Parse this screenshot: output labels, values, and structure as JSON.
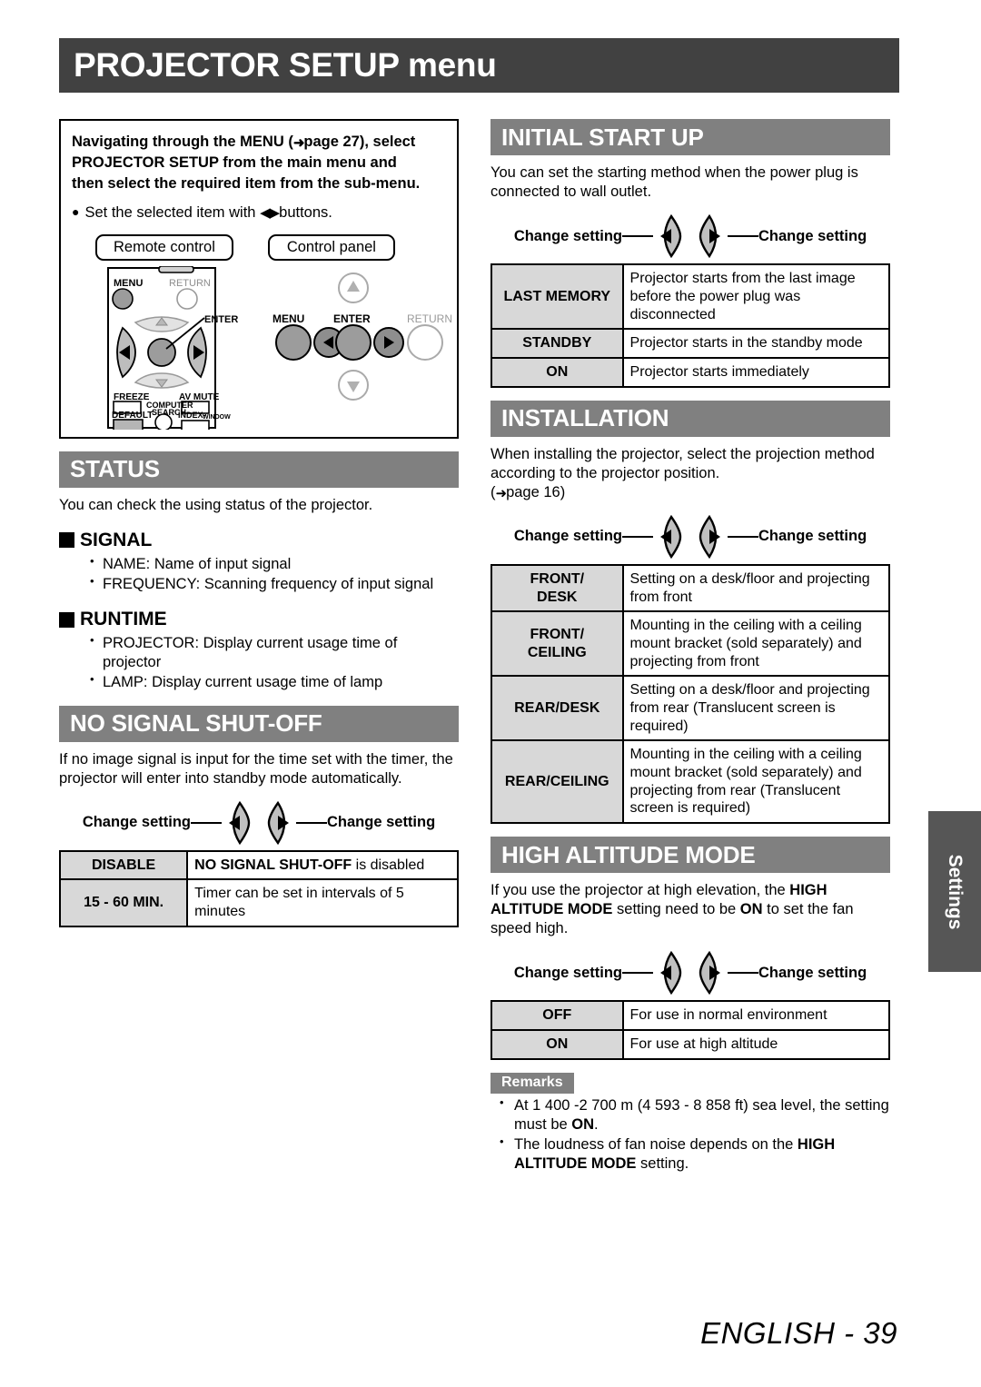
{
  "page": {
    "title_main": "PROJECTOR SETUP",
    "title_suffix": " menu",
    "footer": "ENGLISH - 39",
    "side_tab": "Settings",
    "colors": {
      "title_bar": "#414141",
      "section_bar": "#808080",
      "table_key_bg": "#d8d8d8",
      "side_tab_bg": "#565656"
    }
  },
  "nav_box": {
    "heading_line1": "Navigating through the MENU (",
    "heading_arrow": "➜",
    "heading_line1b": "page 27), select",
    "heading_line2": "PROJECTOR SETUP from the main menu and",
    "heading_line3": "then select the required item from the sub-menu.",
    "bullet_pre": "Set the selected item with",
    "bullet_glyph": "◀▶",
    "bullet_post": "buttons.",
    "device_remote_label": "Remote control",
    "device_panel_label": "Control panel",
    "remote_keys": {
      "menu": "MENU",
      "return": "RETURN",
      "enter": "ENTER",
      "freeze": "FREEZE",
      "av_mute": "AV MUTE",
      "default": "DEFAULT",
      "computer_search": "COMPUTER\nSEARCH",
      "index_window": "INDEX-WINDOW"
    },
    "panel_keys": {
      "menu": "MENU",
      "enter": "ENTER",
      "return": "RETURN"
    }
  },
  "status": {
    "title": "STATUS",
    "intro": "You can check the using status of the projector.",
    "groups": [
      {
        "heading": "SIGNAL",
        "items": [
          "NAME: Name of input signal",
          "FREQUENCY: Scanning frequency of input signal"
        ]
      },
      {
        "heading": "RUNTIME",
        "items": [
          "PROJECTOR: Display current usage time of projector",
          "LAMP: Display current usage time of lamp"
        ]
      }
    ]
  },
  "no_signal_shut_off": {
    "title": "NO SIGNAL SHUT-OFF",
    "intro": "If no image signal is input for the time set with the timer, the projector will enter into standby mode automatically.",
    "change_left": "Change setting",
    "change_right": "Change setting",
    "rows": [
      {
        "key": "DISABLE",
        "value_bold": "NO SIGNAL SHUT-OFF",
        "value_rest": " is disabled"
      },
      {
        "key": "15 - 60 MIN.",
        "value_bold": "",
        "value_rest": "Timer can be set in intervals of 5 minutes"
      }
    ]
  },
  "initial_start_up": {
    "title": "INITIAL START UP",
    "intro": "You can set the starting method when the power plug is connected to wall outlet.",
    "change_left": "Change setting",
    "change_right": "Change setting",
    "rows": [
      {
        "key": "LAST MEMORY",
        "value": "Projector starts from the last image before the power plug was disconnected"
      },
      {
        "key": "STANDBY",
        "value": "Projector starts in the standby mode"
      },
      {
        "key": "ON",
        "value": "Projector starts immediately"
      }
    ]
  },
  "installation": {
    "title": "INSTALLATION",
    "intro_line1": "When installing the projector, select the projection method according to the projector position.",
    "intro_page_ref_open": "(",
    "intro_page_ref_arrow": "➜",
    "intro_page_ref": "page 16)",
    "change_left": "Change setting",
    "change_right": "Change setting",
    "rows": [
      {
        "key": "FRONT/\nDESK",
        "value": "Setting on a desk/floor and projecting from front"
      },
      {
        "key": "FRONT/\nCEILING",
        "value": "Mounting in the ceiling with a ceiling mount bracket (sold separately) and projecting from front"
      },
      {
        "key": "REAR/DESK",
        "value": "Setting on a desk/floor and projecting from rear (Translucent screen is required)"
      },
      {
        "key": "REAR/CEILING",
        "value": "Mounting in the ceiling with a ceiling mount bracket (sold separately) and projecting from rear (Translucent screen is required)"
      }
    ]
  },
  "high_altitude_mode": {
    "title": "HIGH ALTITUDE MODE",
    "intro_a": "If you use the projector at high elevation, the ",
    "intro_b": "HIGH ALTITUDE MODE",
    "intro_c": " setting need to be ",
    "intro_d": "ON",
    "intro_e": " to set the fan speed high.",
    "change_left": "Change setting",
    "change_right": "Change setting",
    "rows": [
      {
        "key": "OFF",
        "value": "For use in normal environment"
      },
      {
        "key": "ON",
        "value": "For use at high altitude"
      }
    ],
    "remarks_label": "Remarks",
    "remarks": [
      {
        "a": "At 1 400 -2 700 m (4 593 - 8 858 ft) sea level, the setting must be ",
        "b": "ON",
        "c": "."
      },
      {
        "a": "The loudness of fan noise depends on the ",
        "b": "HIGH ALTITUDE MODE",
        "c": " setting."
      }
    ]
  }
}
